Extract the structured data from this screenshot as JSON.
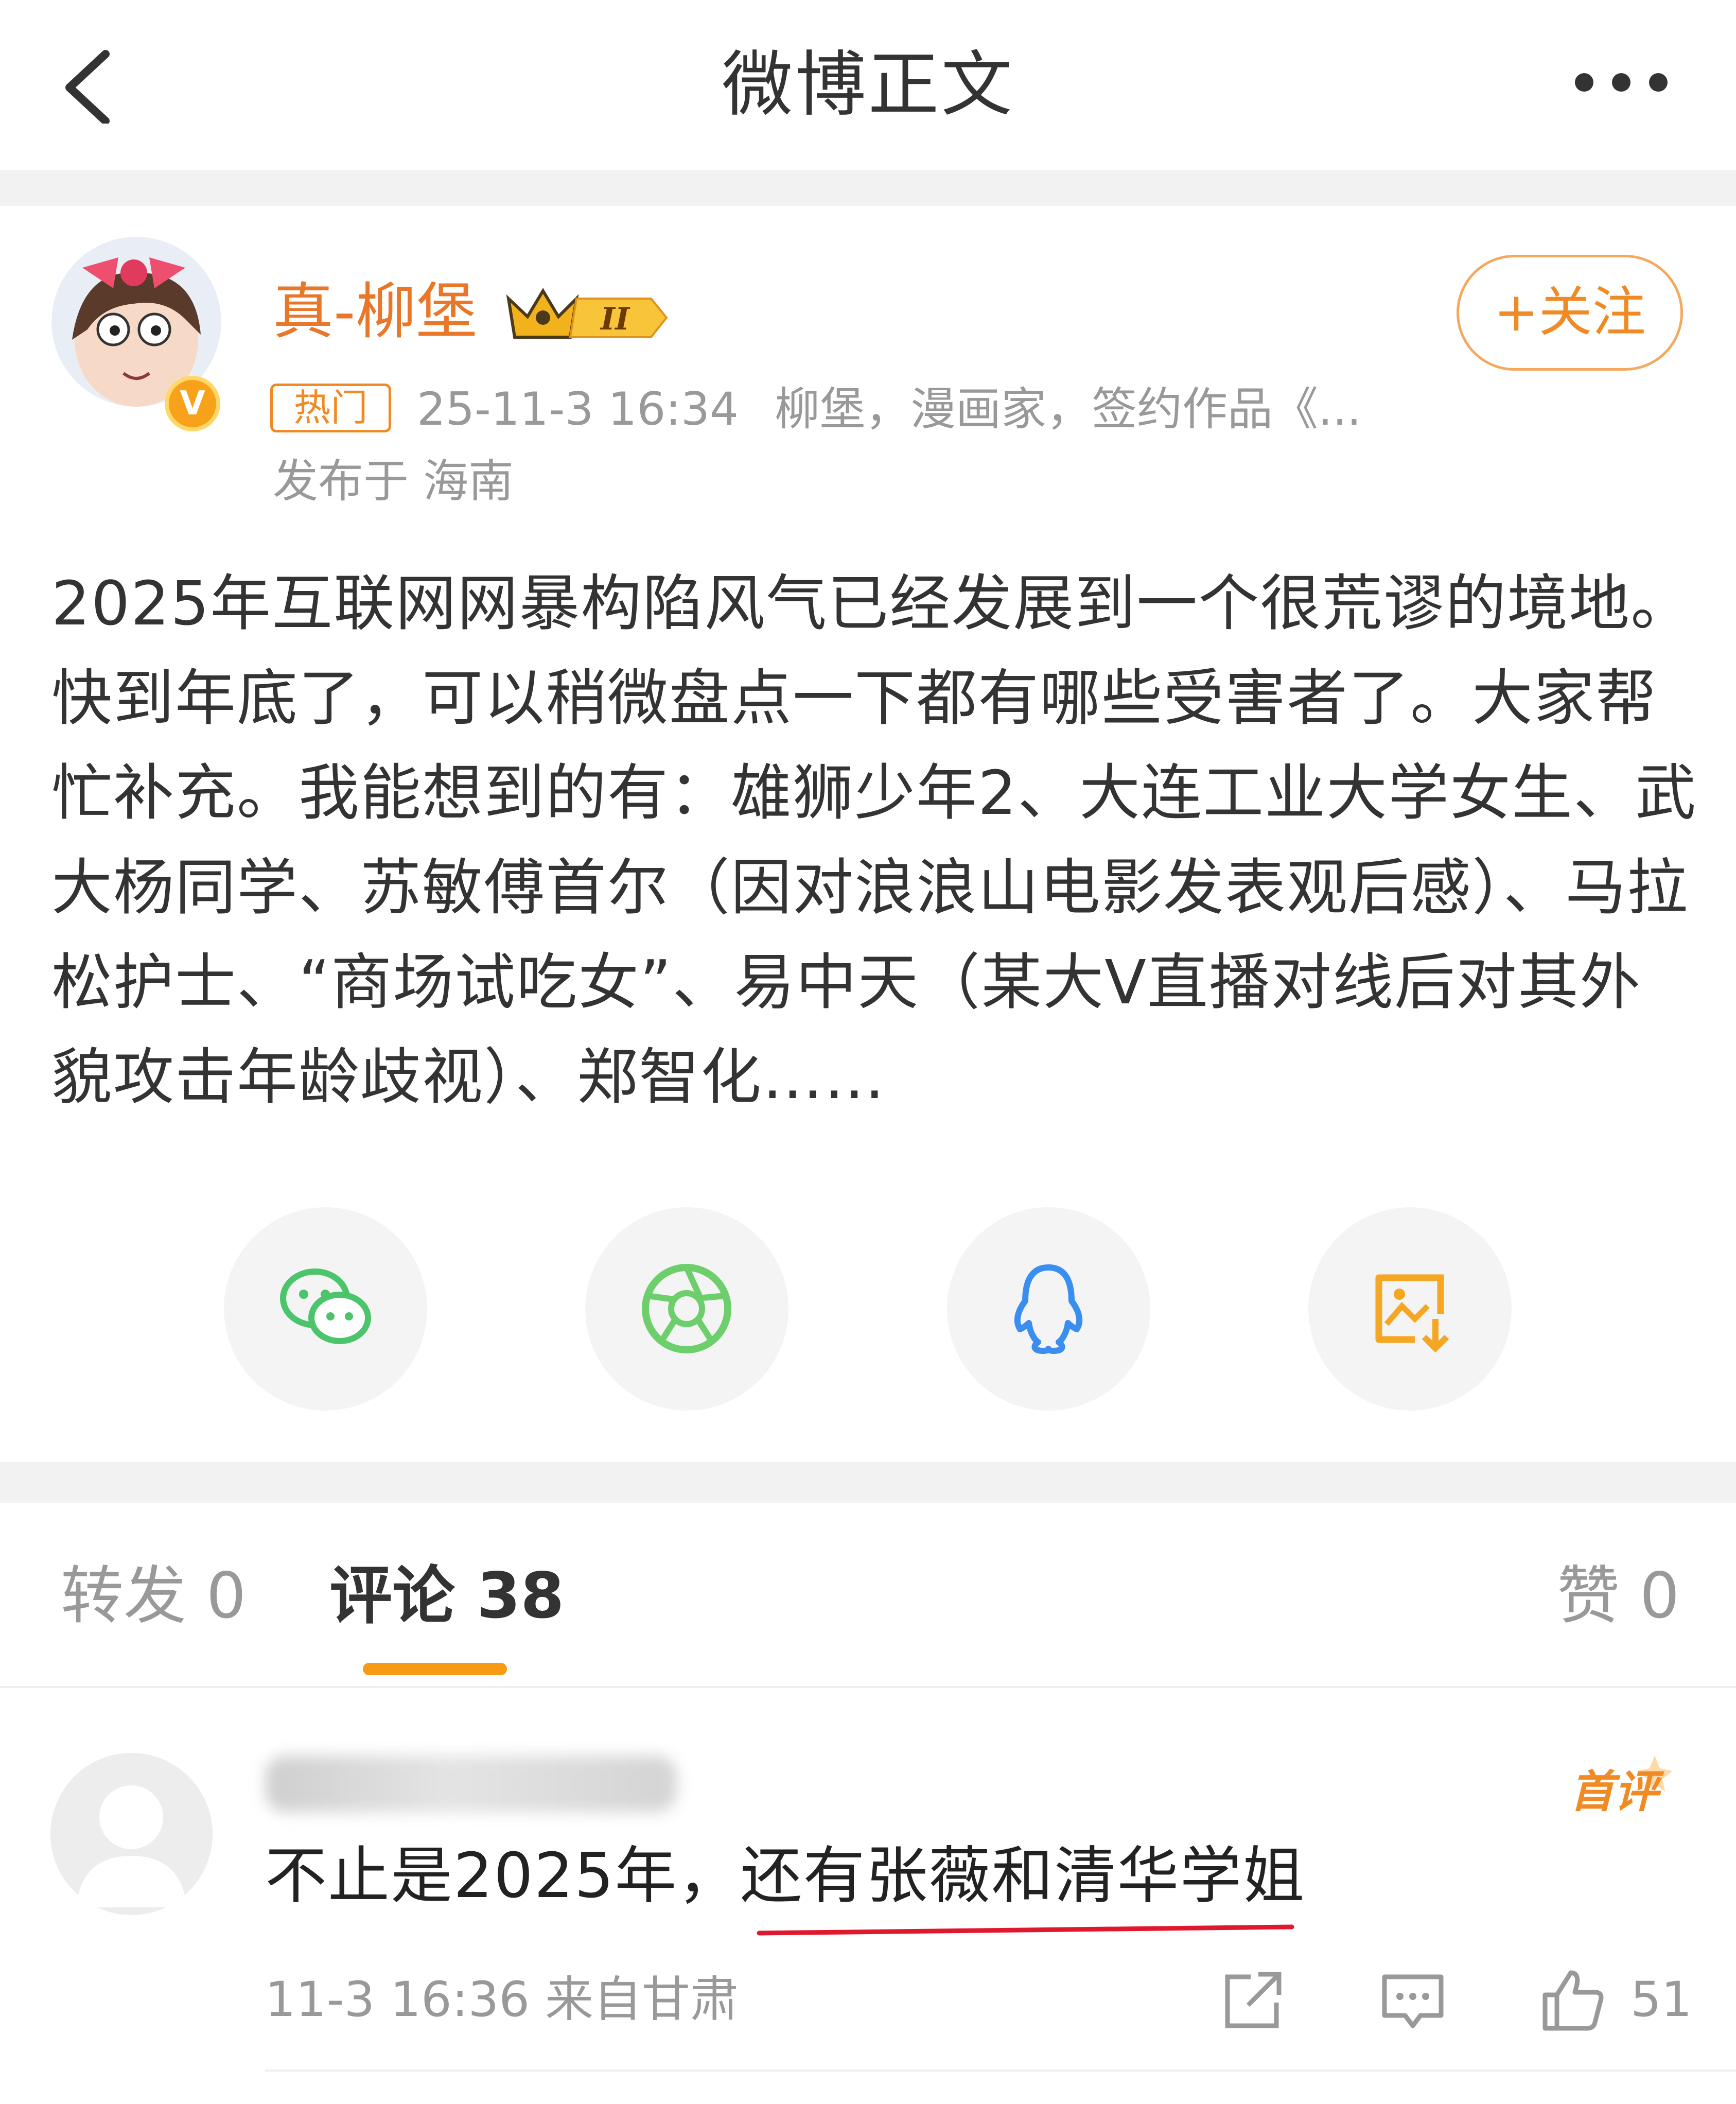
{
  "header": {
    "title": "微博正文",
    "back_icon": "back-arrow-icon",
    "more_icon": "more-dots-icon"
  },
  "author": {
    "name": "真-柳堡",
    "verified_badge": "V",
    "level_badge": "II",
    "follow_label": "+关注",
    "hot_tag": "热门",
    "time": "25-11-3 16:34",
    "bio": "柳堡，漫画家，签约作品《...",
    "location": "发布于 海南"
  },
  "post": {
    "text": "2025年互联网网暴构陷风气已经发展到一个很荒谬的境地。快到年底了，可以稍微盘点一下都有哪些受害者了。大家帮忙补充。我能想到的有：雄狮少年2、大连工业大学女生、武大杨同学、苏敏傅首尔（因对浪浪山电影发表观后感）、马拉松护士、“商场试吃女”、易中天（某大V直播对线后对其外貌攻击年龄歧视）、郑智化……"
  },
  "share": [
    "wechat-icon",
    "moments-icon",
    "qq-icon",
    "save-image-icon"
  ],
  "tabs": {
    "repost": "转发 0",
    "comments": "评论 38",
    "likes": "赞 0"
  },
  "comment": {
    "first_badge": "首评",
    "text_plain": "不止是2025年，",
    "text_highlight": "还有张薇和清华学姐",
    "time_location": "11-3 16:36  来自甘肃",
    "like_count": "51"
  },
  "colors": {
    "accent": "#f08a24",
    "tab_underline": "#f79a14",
    "red_mark": "#e0182d"
  }
}
